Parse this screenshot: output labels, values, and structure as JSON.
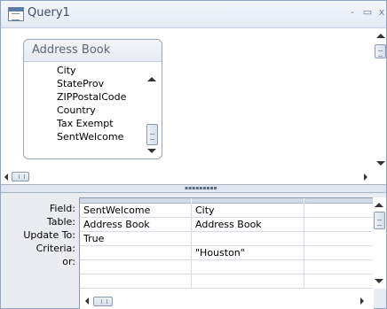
{
  "window": {
    "title": "Query1",
    "controls": {
      "minimize": "-",
      "maximize": "▭",
      "close": "x"
    }
  },
  "field_list": {
    "title": "Address Book",
    "items": [
      "City",
      "StateProv",
      "ZIPPostalCode",
      "Country",
      "Tax Exempt",
      "SentWelcome"
    ]
  },
  "design_grid": {
    "row_labels": [
      "Field:",
      "Table:",
      "Update To:",
      "Criteria:",
      "or:"
    ],
    "columns": [
      {
        "field": "SentWelcome",
        "table": "Address Book",
        "update_to": "True",
        "criteria": "",
        "or": ""
      },
      {
        "field": "City",
        "table": "Address Book",
        "update_to": "",
        "criteria": "\"Houston\"",
        "or": ""
      },
      {
        "field": "",
        "table": "",
        "update_to": "",
        "criteria": "",
        "or": ""
      }
    ]
  },
  "icons": {
    "window_icon": "query-icon",
    "scroll_up": "arrow-up-icon",
    "scroll_down": "arrow-down-icon",
    "scroll_left": "arrow-left-icon",
    "scroll_right": "arrow-right-icon"
  }
}
